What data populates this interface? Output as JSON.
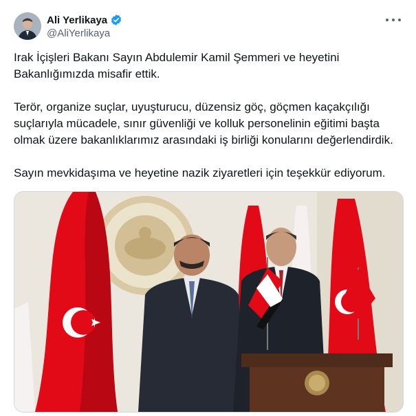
{
  "user": {
    "display_name": "Ali Yerlikaya",
    "handle": "@AliYerlikaya",
    "verified": true
  },
  "icons": {
    "avatar": "avatar",
    "verified": "verified-badge-icon",
    "more": "more-icon"
  },
  "tweet": {
    "paragraphs": [
      "Irak İçişleri Bakanı Sayın Abdulemir Kamil Şemmeri ve heyetini\nBakanlığımızda misafir ettik.",
      "Terör, organize suçlar, uyuşturucu,  düzensiz göç, göçmen kaçakçılığı\nsuçlarıyla mücadele, sınır güvenliği ve kolluk personelinin eğitimi başta\nolmak üzere bakanlıklarımız arasındaki iş birliği konularını değerlendirdik.",
      "Sayın mevkidaşıma ve heyetine nazik ziyaretleri için teşekkür ediyorum."
    ]
  },
  "colors": {
    "verified": "#1d9bf0",
    "text": "#0f1419",
    "secondary": "#536471",
    "flag_red": "#e30a17"
  }
}
